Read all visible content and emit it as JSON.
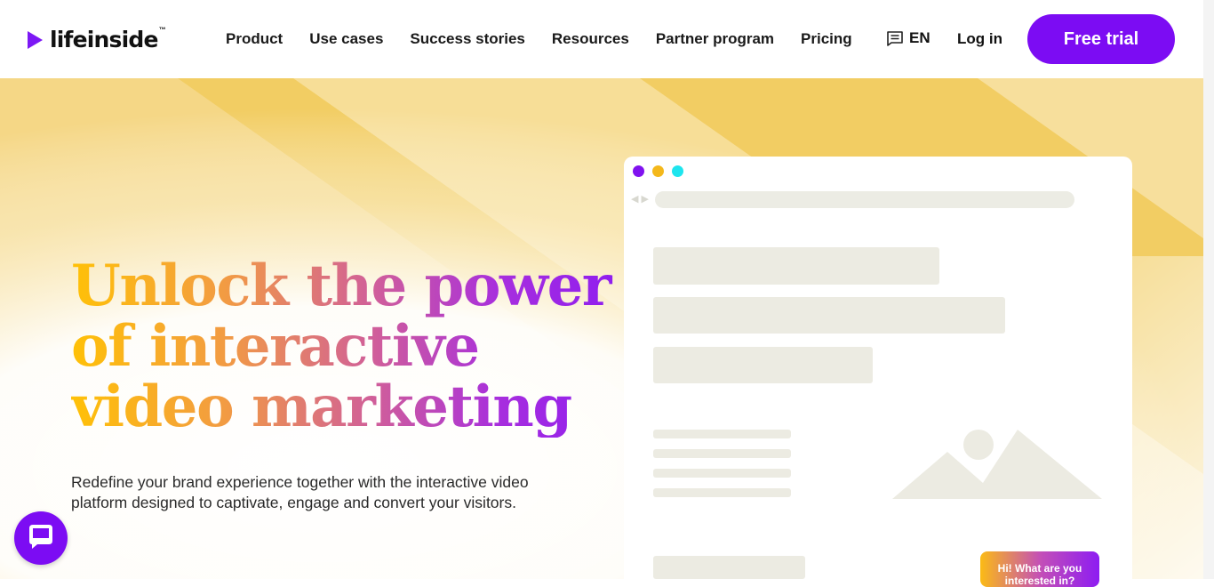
{
  "brand": {
    "name": "lifeinside",
    "tm": "™"
  },
  "nav": {
    "items": [
      "Product",
      "Use cases",
      "Success stories",
      "Resources",
      "Partner program",
      "Pricing"
    ]
  },
  "header": {
    "language": "EN",
    "language_icon": "chat-lines-icon",
    "login_label": "Log in",
    "trial_label": "Free trial"
  },
  "hero": {
    "headline_lines": [
      "Unlock the power",
      "of interactive",
      "video marketing"
    ],
    "subtitle_lines": [
      "Redefine your brand experience together with the interactive video",
      "platform designed to captivate, engage and convert your visitors."
    ]
  },
  "mockup": {
    "chat_preview": "Hi! What are you interested in?"
  },
  "colors": {
    "brand_purple": "#7c0cf3",
    "hero_gold": "#f2cd63",
    "dot_purple": "#8012ef",
    "dot_yellow": "#f4b81b",
    "dot_cyan": "#1ee5ee",
    "placeholder": "#ecebe2"
  }
}
